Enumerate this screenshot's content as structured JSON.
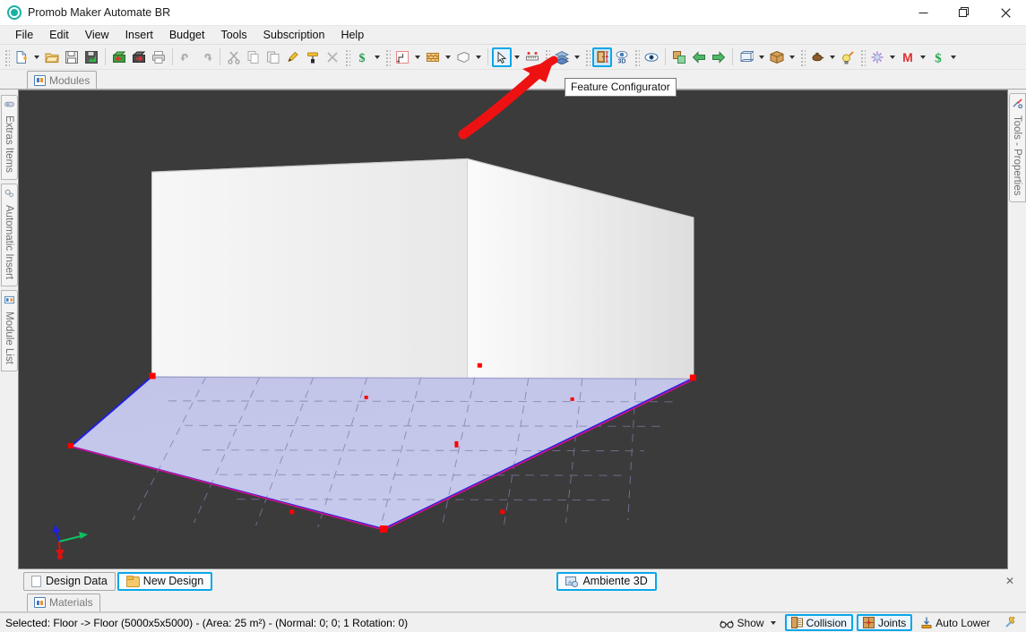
{
  "window": {
    "title": "Promob Maker Automate BR",
    "app_icon": "promob-logo-icon",
    "minimize": "—",
    "restore": "❐",
    "close": "✕"
  },
  "menubar": {
    "items": [
      {
        "label": "File"
      },
      {
        "label": "Edit"
      },
      {
        "label": "View"
      },
      {
        "label": "Insert"
      },
      {
        "label": "Budget"
      },
      {
        "label": "Tools"
      },
      {
        "label": "Subscription"
      },
      {
        "label": "Help"
      }
    ]
  },
  "toolbar": {
    "groups": [
      {
        "buttons": [
          {
            "name": "new-document-button",
            "icon": "new-document-icon",
            "dropdown": true
          },
          {
            "name": "open-button",
            "icon": "open-folder-icon",
            "dropdown": false
          },
          {
            "name": "save-button",
            "icon": "floppy-save-icon",
            "dropdown": false
          },
          {
            "name": "save-as-button",
            "icon": "floppy-save-as-icon",
            "dropdown": false
          }
        ]
      },
      {
        "buttons": [
          {
            "name": "import-button",
            "icon": "import-green-arrow-icon",
            "dropdown": false
          },
          {
            "name": "export-button",
            "icon": "export-red-arrow-icon",
            "dropdown": false
          },
          {
            "name": "print-button",
            "icon": "printer-icon",
            "dropdown": false
          }
        ]
      },
      {
        "buttons": [
          {
            "name": "undo-button",
            "icon": "undo-arrow-icon",
            "dropdown": false
          },
          {
            "name": "redo-button",
            "icon": "redo-arrow-icon",
            "dropdown": false
          }
        ]
      },
      {
        "buttons": [
          {
            "name": "cut-button",
            "icon": "scissors-icon",
            "dropdown": false
          },
          {
            "name": "copy-button",
            "icon": "copy-pages-icon",
            "dropdown": false
          },
          {
            "name": "paste-button",
            "icon": "paste-pages-icon",
            "dropdown": false
          },
          {
            "name": "format-brush-button",
            "icon": "yellow-brush-icon",
            "dropdown": false
          },
          {
            "name": "paint-roller-button",
            "icon": "paint-roller-icon",
            "dropdown": false
          },
          {
            "name": "delete-button",
            "icon": "close-x-icon",
            "dropdown": false
          }
        ]
      },
      {
        "buttons": [
          {
            "name": "budget-button",
            "icon": "dollar-sign-icon",
            "dropdown": true
          }
        ]
      },
      {
        "buttons": [
          {
            "name": "environment-button",
            "icon": "room-outline-icon",
            "dropdown": true
          },
          {
            "name": "wall-button",
            "icon": "brick-wall-icon",
            "dropdown": true
          },
          {
            "name": "ceiling-button",
            "icon": "ceiling-shape-icon",
            "dropdown": true
          }
        ]
      },
      {
        "buttons": [
          {
            "name": "select-tool-button",
            "icon": "cursor-arrow-icon",
            "dropdown": true,
            "state": "selected"
          },
          {
            "name": "measure-tool-button",
            "icon": "ruler-measure-icon",
            "dropdown": false
          }
        ]
      },
      {
        "buttons": [
          {
            "name": "layers-button",
            "icon": "layers-stack-icon",
            "dropdown": true
          }
        ]
      },
      {
        "buttons": [
          {
            "name": "feature-configurator-button",
            "icon": "door-configurator-icon",
            "dropdown": false,
            "state": "active"
          },
          {
            "name": "view-3d-button",
            "icon": "eye-3d-icon",
            "dropdown": false
          }
        ]
      },
      {
        "buttons": [
          {
            "name": "visibility-button",
            "icon": "eye-icon",
            "dropdown": false
          }
        ]
      },
      {
        "buttons": [
          {
            "name": "group-button",
            "icon": "group-boxes-icon",
            "dropdown": false
          },
          {
            "name": "previous-button",
            "icon": "green-arrow-left-icon",
            "dropdown": false
          },
          {
            "name": "next-button",
            "icon": "green-arrow-right-icon",
            "dropdown": false
          }
        ]
      },
      {
        "buttons": [
          {
            "name": "perspective-button",
            "icon": "wireframe-cube-icon",
            "dropdown": true
          },
          {
            "name": "render-box-button",
            "icon": "cardboard-box-icon",
            "dropdown": true
          }
        ]
      },
      {
        "buttons": [
          {
            "name": "lighting-button",
            "icon": "lamp-icon",
            "dropdown": true
          },
          {
            "name": "bulb-button",
            "icon": "light-bulb-icon",
            "dropdown": false
          }
        ]
      },
      {
        "buttons": [
          {
            "name": "effects-button",
            "icon": "sparkle-burst-icon",
            "dropdown": true
          },
          {
            "name": "promob-m-button",
            "icon": "red-m-icon",
            "dropdown": true
          },
          {
            "name": "price-button",
            "icon": "green-dollar-icon",
            "dropdown": true
          }
        ]
      }
    ]
  },
  "tooltip": {
    "text": "Feature Configurator"
  },
  "annotation": {
    "type": "red-arrow",
    "color": "#ee1111",
    "points_to": "feature-configurator-button"
  },
  "modules_tab": {
    "label": "Modules",
    "icon": "modules-icon"
  },
  "left_sidebar": {
    "items": [
      {
        "label": "Extras Items",
        "icon": "extras-items-icon"
      },
      {
        "label": "Automatic Insert",
        "icon": "gears-icon"
      },
      {
        "label": "Module List",
        "icon": "module-list-icon"
      }
    ]
  },
  "right_sidebar": {
    "items": [
      {
        "label": "Tools - Properties",
        "icon": "tools-wrench-screwdriver-icon"
      }
    ]
  },
  "viewport": {
    "background_color": "#3b3b3b",
    "floor_color": "#b7b9e4",
    "wall_color": "#f2f2f2",
    "vertex_color": "#ff0000",
    "edge_color": "#2020dd",
    "axis_gizmo": {
      "x_color": "#10c060",
      "y_color": "#2020dd",
      "z_color": "#dd1010"
    }
  },
  "bottom_tabs": {
    "tabs": [
      {
        "label": "Design Data",
        "icon": "document-icon",
        "selected": false
      },
      {
        "label": "New Design",
        "icon": "folder-icon",
        "selected": true
      }
    ],
    "center_tab": {
      "label": "Ambiente 3D",
      "icon": "ambiente-3d-icon",
      "selected": true
    },
    "close_label": "✕"
  },
  "materials_tab": {
    "label": "Materials",
    "icon": "materials-icon"
  },
  "statusbar": {
    "selection_text": "Selected: Floor -> Floor (5000x5x5000) - (Area: 25 m²) - (Normal: 0; 0; 1 Rotation: 0)",
    "right_items": [
      {
        "label": "Show",
        "icon": "show-glasses-icon",
        "dropdown": true,
        "boxed": false
      },
      {
        "label": "Collision",
        "icon": "collision-icon",
        "dropdown": false,
        "boxed": true
      },
      {
        "label": "Joints",
        "icon": "joints-icon",
        "dropdown": false,
        "boxed": true
      },
      {
        "label": "Auto Lower",
        "icon": "auto-lower-icon",
        "dropdown": false,
        "boxed": false
      },
      {
        "label": "",
        "icon": "wrench-icon",
        "dropdown": false,
        "boxed": false
      }
    ]
  }
}
